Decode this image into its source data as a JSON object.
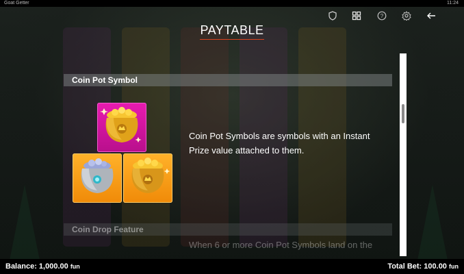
{
  "top_bar": {
    "game_name": "Goat Getter",
    "clock": "11:24"
  },
  "toolbar": {
    "icons": [
      "shield-icon",
      "grid-icon",
      "help-icon",
      "gear-icon",
      "back-arrow-icon"
    ]
  },
  "page_title": "PAYTABLE",
  "sections": [
    {
      "header": "Coin Pot Symbol",
      "description": "Coin Pot Symbols are symbols with an Instant Prize value attached to them.",
      "symbols": [
        {
          "name": "gold-coin-pot",
          "tile": "pink"
        },
        {
          "name": "silver-coin-pot",
          "tile": "orange"
        },
        {
          "name": "gold-coin-pot",
          "tile": "orange"
        }
      ]
    },
    {
      "header": "Coin Drop Feature",
      "description": "When 6 or more Coin Pot Symbols land on the"
    }
  ],
  "balance": {
    "label": "Balance:",
    "value": "1,000.00",
    "currency": "fun"
  },
  "total_bet": {
    "label": "Total Bet:",
    "value": "100.00",
    "currency": "fun"
  },
  "colors": {
    "accent_underline": "#d9421f",
    "pink_tile": "#e81bb0",
    "orange_tile": "#f5960e"
  }
}
